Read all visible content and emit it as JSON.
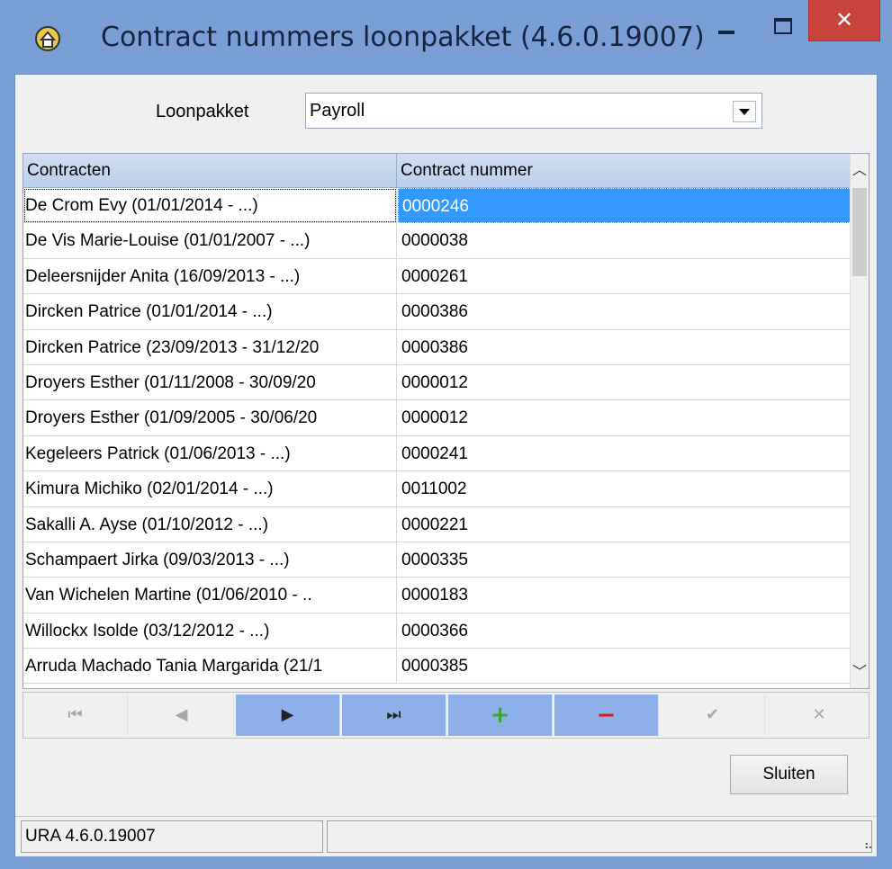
{
  "window": {
    "title": "Contract nummers loonpakket (4.6.0.19007)",
    "icons": {
      "app": "house-gear-icon",
      "minimize": "minimize-icon",
      "maximize": "maximize-icon",
      "close": "close-icon"
    },
    "close_glyph": "✕"
  },
  "form": {
    "loonpakket_label": "Loonpakket",
    "loonpakket_value": "Payroll"
  },
  "grid": {
    "columns": [
      "Contracten",
      "Contract nummer"
    ],
    "rows": [
      {
        "contract": "De Crom Evy (01/01/2014 - ...)",
        "nummer": "0000246"
      },
      {
        "contract": "De Vis Marie-Louise (01/01/2007 - ...)",
        "nummer": "0000038"
      },
      {
        "contract": "Deleersnijder Anita (16/09/2013 - ...)",
        "nummer": "0000261"
      },
      {
        "contract": "Dircken Patrice (01/01/2014 - ...)",
        "nummer": "0000386"
      },
      {
        "contract": "Dircken Patrice (23/09/2013 - 31/12/20",
        "nummer": "0000386"
      },
      {
        "contract": "Droyers Esther (01/11/2008 - 30/09/20",
        "nummer": "0000012"
      },
      {
        "contract": "Droyers Esther (01/09/2005 - 30/06/20",
        "nummer": "0000012"
      },
      {
        "contract": "Kegeleers Patrick (01/06/2013 - ...)",
        "nummer": "0000241"
      },
      {
        "contract": "Kimura Michiko (02/01/2014 - ...)",
        "nummer": "0011002"
      },
      {
        "contract": "Sakalli A. Ayse (01/10/2012 - ...)",
        "nummer": "0000221"
      },
      {
        "contract": "Schampaert Jirka (09/03/2013 - ...)",
        "nummer": "0000335"
      },
      {
        "contract": "Van Wichelen Martine (01/06/2010 - ..",
        "nummer": "0000183"
      },
      {
        "contract": "Willockx Isolde (03/12/2012 - ...)",
        "nummer": "0000366"
      },
      {
        "contract": "Arruda Machado Tania Margarida (21/1",
        "nummer": "0000385"
      }
    ],
    "selected_index": 0
  },
  "navigator": {
    "first": "⏮",
    "prior": "◀",
    "next": "▶",
    "last": "⏭",
    "insert": "+",
    "delete": "−",
    "post": "✔",
    "cancel": "✕"
  },
  "actions": {
    "close_label": "Sluiten"
  },
  "statusbar": {
    "version": "URA 4.6.0.19007"
  },
  "colors": {
    "titlebar": "#7a9fd4",
    "close_button": "#c8443a",
    "selection": "#3399ff",
    "nav_active": "#8db0e8"
  }
}
